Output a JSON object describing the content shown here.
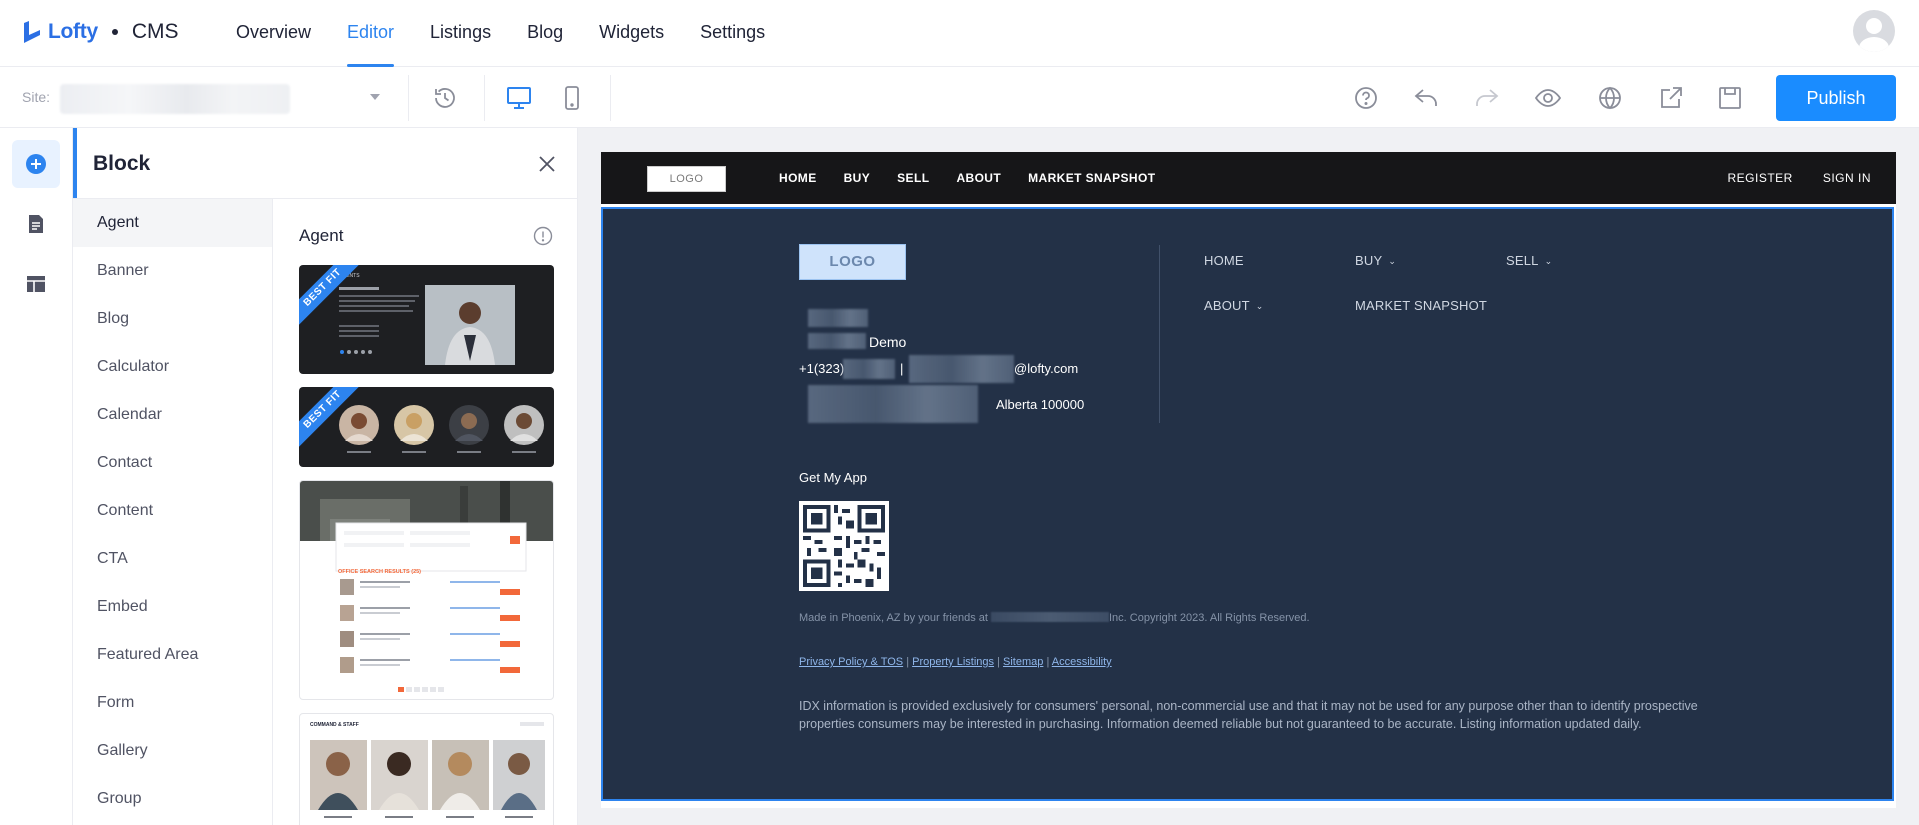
{
  "app": {
    "brand_name": "Lofty",
    "product": "CMS",
    "brand_color": "#2b6fe4",
    "accent_color": "#2d84ef"
  },
  "nav": {
    "tabs": [
      {
        "label": "Overview"
      },
      {
        "label": "Editor",
        "active": true
      },
      {
        "label": "Listings"
      },
      {
        "label": "Blog"
      },
      {
        "label": "Widgets"
      },
      {
        "label": "Settings"
      }
    ],
    "user_avatar_icon": "user-avatar-icon"
  },
  "toolbar": {
    "site_label": "Site:",
    "icons": [
      "history-icon",
      "desktop-icon",
      "mobile-icon",
      "help-icon",
      "undo-icon",
      "redo-icon",
      "preview-eye-icon",
      "globe-icon",
      "share-export-icon",
      "save-icon"
    ],
    "publish_label": "Publish"
  },
  "rail": {
    "items": [
      "add-block-icon",
      "page-icon",
      "layout-icon"
    ]
  },
  "panel": {
    "title": "Block",
    "categories": [
      {
        "label": "Agent",
        "active": true
      },
      {
        "label": "Banner"
      },
      {
        "label": "Blog"
      },
      {
        "label": "Calculator"
      },
      {
        "label": "Calendar"
      },
      {
        "label": "Contact"
      },
      {
        "label": "Content"
      },
      {
        "label": "CTA"
      },
      {
        "label": "Embed"
      },
      {
        "label": "Featured Area"
      },
      {
        "label": "Form"
      },
      {
        "label": "Gallery"
      },
      {
        "label": "Group"
      }
    ],
    "section_title": "Agent",
    "ribbon_label": "BEST FIT",
    "thumb_texts": {
      "t1_heading": "AGENTS",
      "t3_heading": "OFFICE SEARCH RESULTS (25)",
      "t4_heading": "COMMAND & STAFF"
    }
  },
  "preview": {
    "header": {
      "logo": "LOGO",
      "nav": [
        "HOME",
        "BUY",
        "SELL",
        "ABOUT",
        "MARKET SNAPSHOT"
      ],
      "register": "REGISTER",
      "sign_in": "SIGN IN"
    },
    "footer": {
      "logo": "LOGO",
      "name_suffix": "Demo",
      "phone_prefix": "+1(323)",
      "phone_sep": "|",
      "email_suffix": "@lofty.com",
      "address_suffix": "Alberta 100000",
      "nav": [
        {
          "label": "HOME",
          "dropdown": false
        },
        {
          "label": "BUY",
          "dropdown": true
        },
        {
          "label": "SELL",
          "dropdown": true
        },
        {
          "label": "ABOUT",
          "dropdown": true
        },
        {
          "label": "MARKET SNAPSHOT",
          "dropdown": false
        }
      ],
      "app_label": "Get My App",
      "made_in_prefix": "Made in Phoenix, AZ by your friends at",
      "made_in_suffix": "Inc. Copyright 2023. All Rights Reserved.",
      "links": [
        "Privacy Policy & TOS",
        "Property Listings",
        "Sitemap",
        "Accessibility"
      ],
      "link_sep": "|",
      "idx_text": "IDX information is provided exclusively for consumers' personal, non-commercial use and that it may not be used for any purpose other than to identify prospective properties consumers may be interested in purchasing. Information deemed reliable but not guaranteed to be accurate. Listing information updated daily.",
      "background_color": "#233147"
    }
  }
}
